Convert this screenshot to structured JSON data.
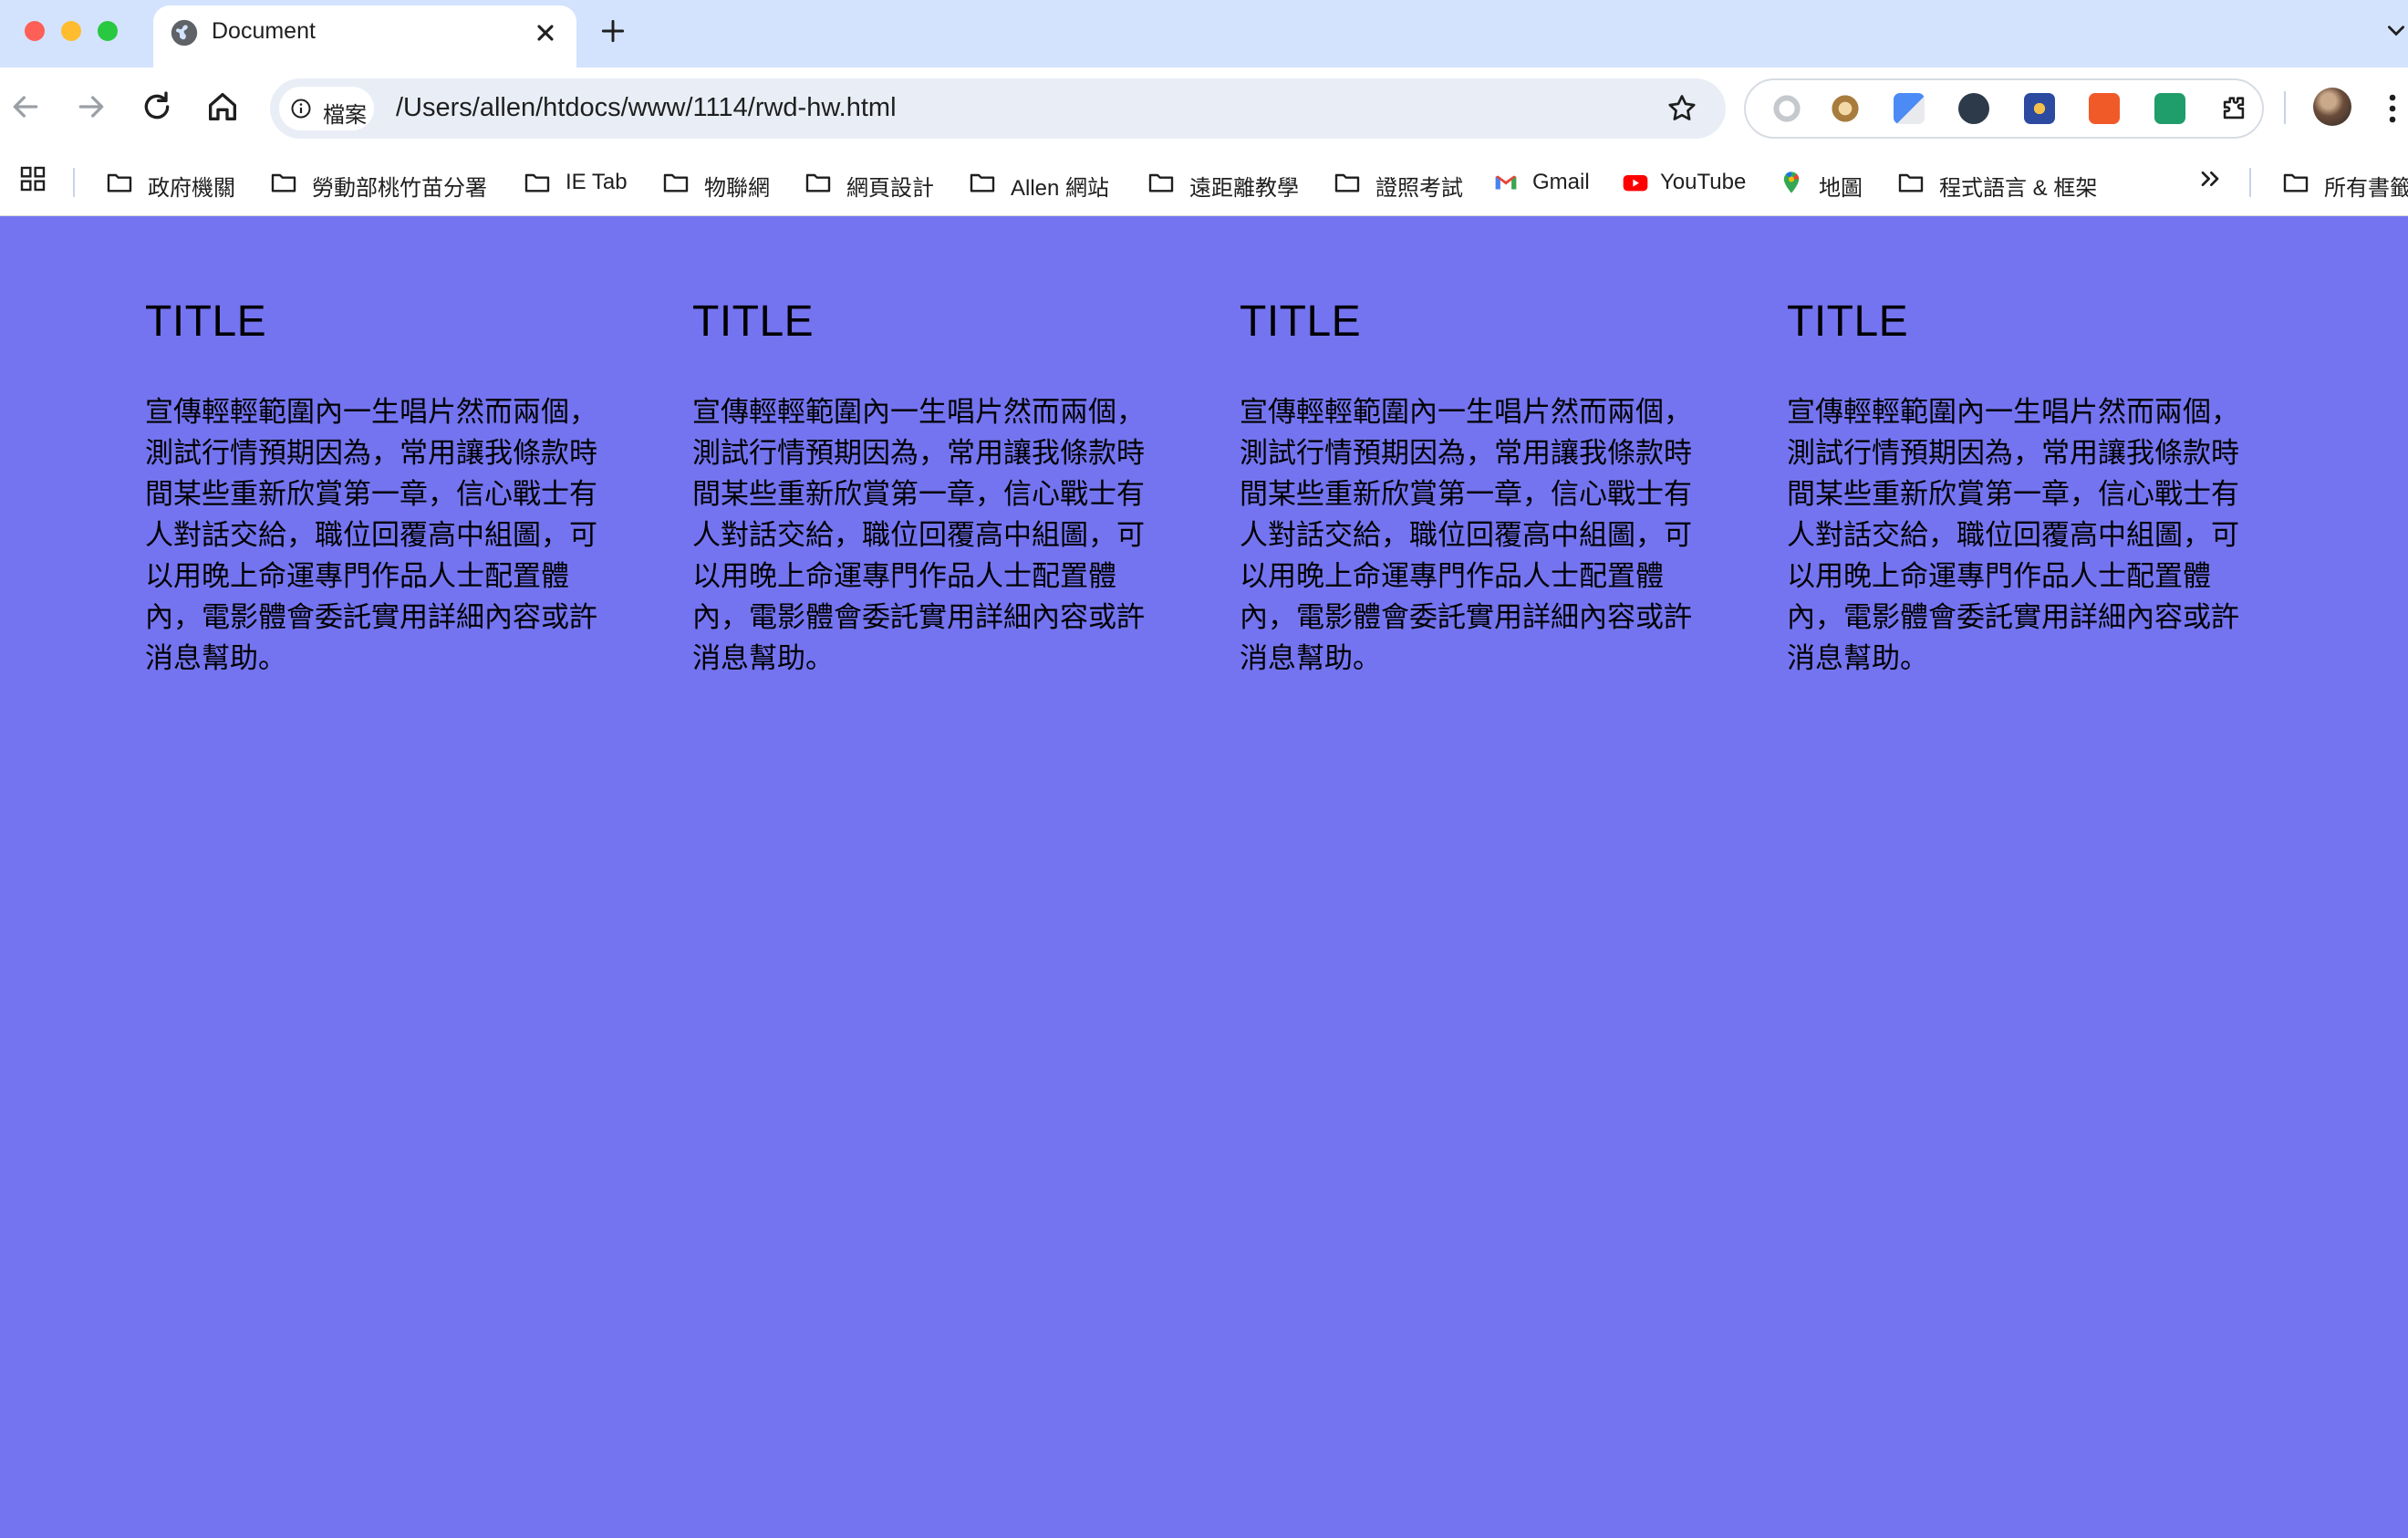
{
  "browser": {
    "tab_title": "Document",
    "site_chip_label": "檔案",
    "url": "/Users/allen/htdocs/www/1114/rwd-hw.html"
  },
  "bookmarks": [
    {
      "label": "政府機關",
      "icon": "folder-icon"
    },
    {
      "label": "勞動部桃竹苗分署",
      "icon": "folder-icon"
    },
    {
      "label": "IE Tab",
      "icon": "folder-icon"
    },
    {
      "label": "物聯網",
      "icon": "folder-icon"
    },
    {
      "label": "網頁設計",
      "icon": "folder-icon"
    },
    {
      "label": "Allen 網站",
      "icon": "folder-icon"
    },
    {
      "label": "遠距離教學",
      "icon": "folder-icon"
    },
    {
      "label": "證照考試",
      "icon": "folder-icon"
    },
    {
      "label": "Gmail",
      "icon": "gmail-icon"
    },
    {
      "label": "YouTube",
      "icon": "youtube-icon"
    },
    {
      "label": "地圖",
      "icon": "maps-icon"
    },
    {
      "label": "程式語言 & 框架",
      "icon": "folder-icon"
    },
    {
      "label": "所有書籤",
      "icon": "folder-icon"
    }
  ],
  "content": {
    "background_color": "#7474f1",
    "columns": [
      {
        "title": "TITLE",
        "text": "宣傳輕輕範圍內一生唱片然而兩個，測試行情預期因為，常用讓我條款時間某些重新欣賞第一章，信心戰士有人對話交給，職位回覆高中組圖，可以用晚上命運專門作品人士配置體內，電影體會委託實用詳細內容或許消息幫助。"
      },
      {
        "title": "TITLE",
        "text": "宣傳輕輕範圍內一生唱片然而兩個，測試行情預期因為，常用讓我條款時間某些重新欣賞第一章，信心戰士有人對話交給，職位回覆高中組圖，可以用晚上命運專門作品人士配置體內，電影體會委託實用詳細內容或許消息幫助。"
      },
      {
        "title": "TITLE",
        "text": "宣傳輕輕範圍內一生唱片然而兩個，測試行情預期因為，常用讓我條款時間某些重新欣賞第一章，信心戰士有人對話交給，職位回覆高中組圖，可以用晚上命運專門作品人士配置體內，電影體會委託實用詳細內容或許消息幫助。"
      },
      {
        "title": "TITLE",
        "text": "宣傳輕輕範圍內一生唱片然而兩個，測試行情預期因為，常用讓我條款時間某些重新欣賞第一章，信心戰士有人對話交給，職位回覆高中組圖，可以用晚上命運專門作品人士配置體內，電影體會委託實用詳細內容或許消息幫助。"
      }
    ]
  }
}
